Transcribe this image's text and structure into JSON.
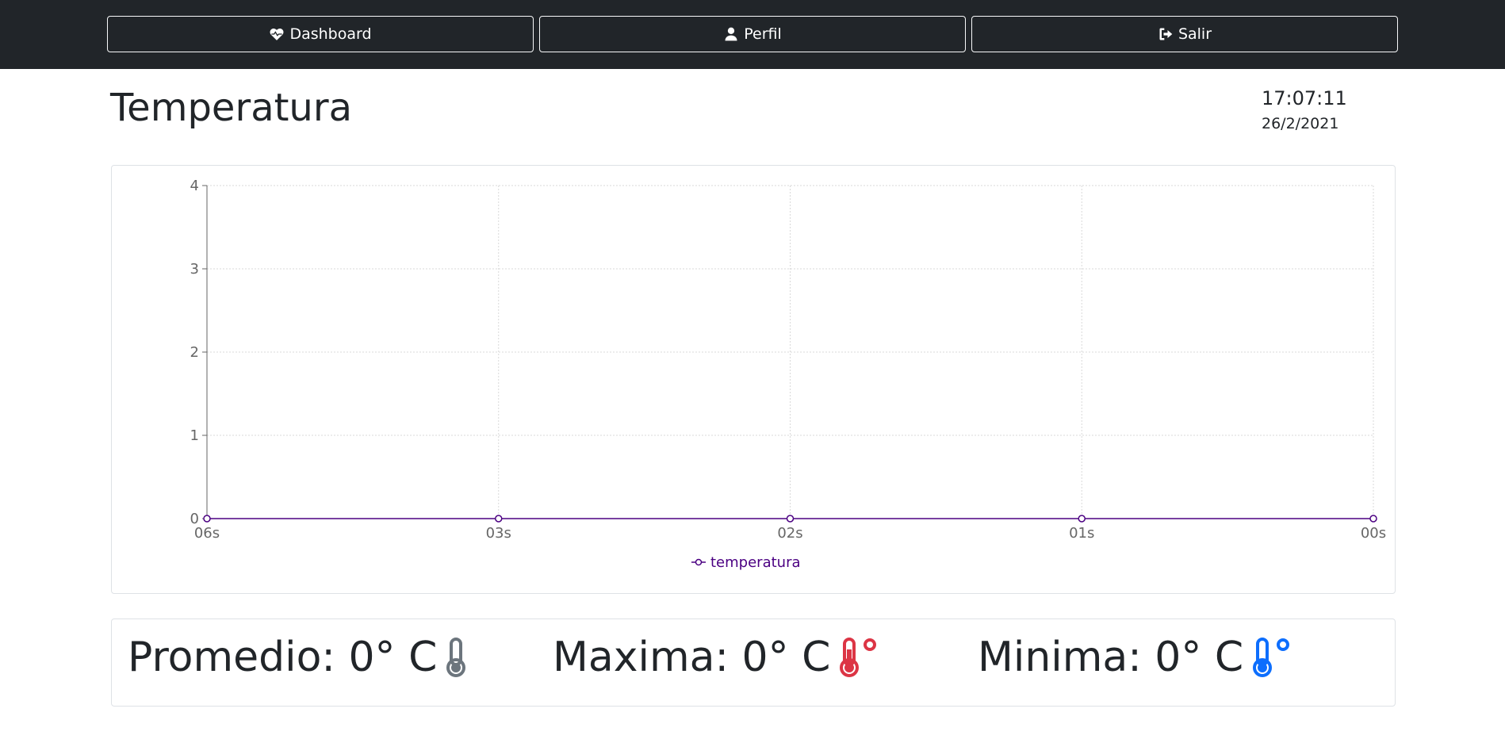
{
  "nav": {
    "dashboard": {
      "label": "Dashboard",
      "icon": "heart-pulse-icon"
    },
    "perfil": {
      "label": "Perfil",
      "icon": "user-icon"
    },
    "salir": {
      "label": "Salir",
      "icon": "sign-out-icon"
    }
  },
  "page": {
    "title": "Temperatura",
    "time": "17:07:11",
    "date": "26/2/2021"
  },
  "chart_data": {
    "type": "line",
    "x": [
      "06s",
      "03s",
      "02s",
      "01s",
      "00s"
    ],
    "series": [
      {
        "name": "temperatura",
        "values": [
          0,
          0,
          0,
          0,
          0
        ],
        "color": "#4b0082"
      }
    ],
    "yticks": [
      "0",
      "1",
      "2",
      "3",
      "4"
    ],
    "ylim": [
      0,
      4
    ],
    "grid": true,
    "legend": "bottom"
  },
  "stats": {
    "promedio": {
      "label": "Promedio: 0° C",
      "icon": "thermometer-icon",
      "color": "#6c757d"
    },
    "maxima": {
      "label": "Maxima: 0° C",
      "icon": "thermometer-hot-icon",
      "color": "#dc3545"
    },
    "minima": {
      "label": "Minima: 0° C",
      "icon": "thermometer-cold-icon",
      "color": "#0d6efd"
    }
  }
}
